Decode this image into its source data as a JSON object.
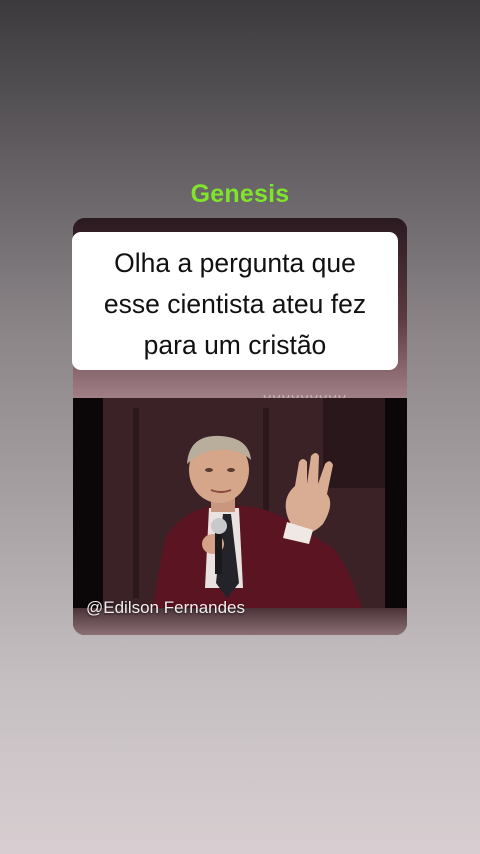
{
  "channel": {
    "title": "Genesis",
    "title_color": "#7ee52b"
  },
  "video": {
    "caption_lines": [
      "Olha a pergunta que",
      "esse cientista ateu fez",
      "para um cristão"
    ],
    "credit": "@Edilson Fernandes"
  }
}
